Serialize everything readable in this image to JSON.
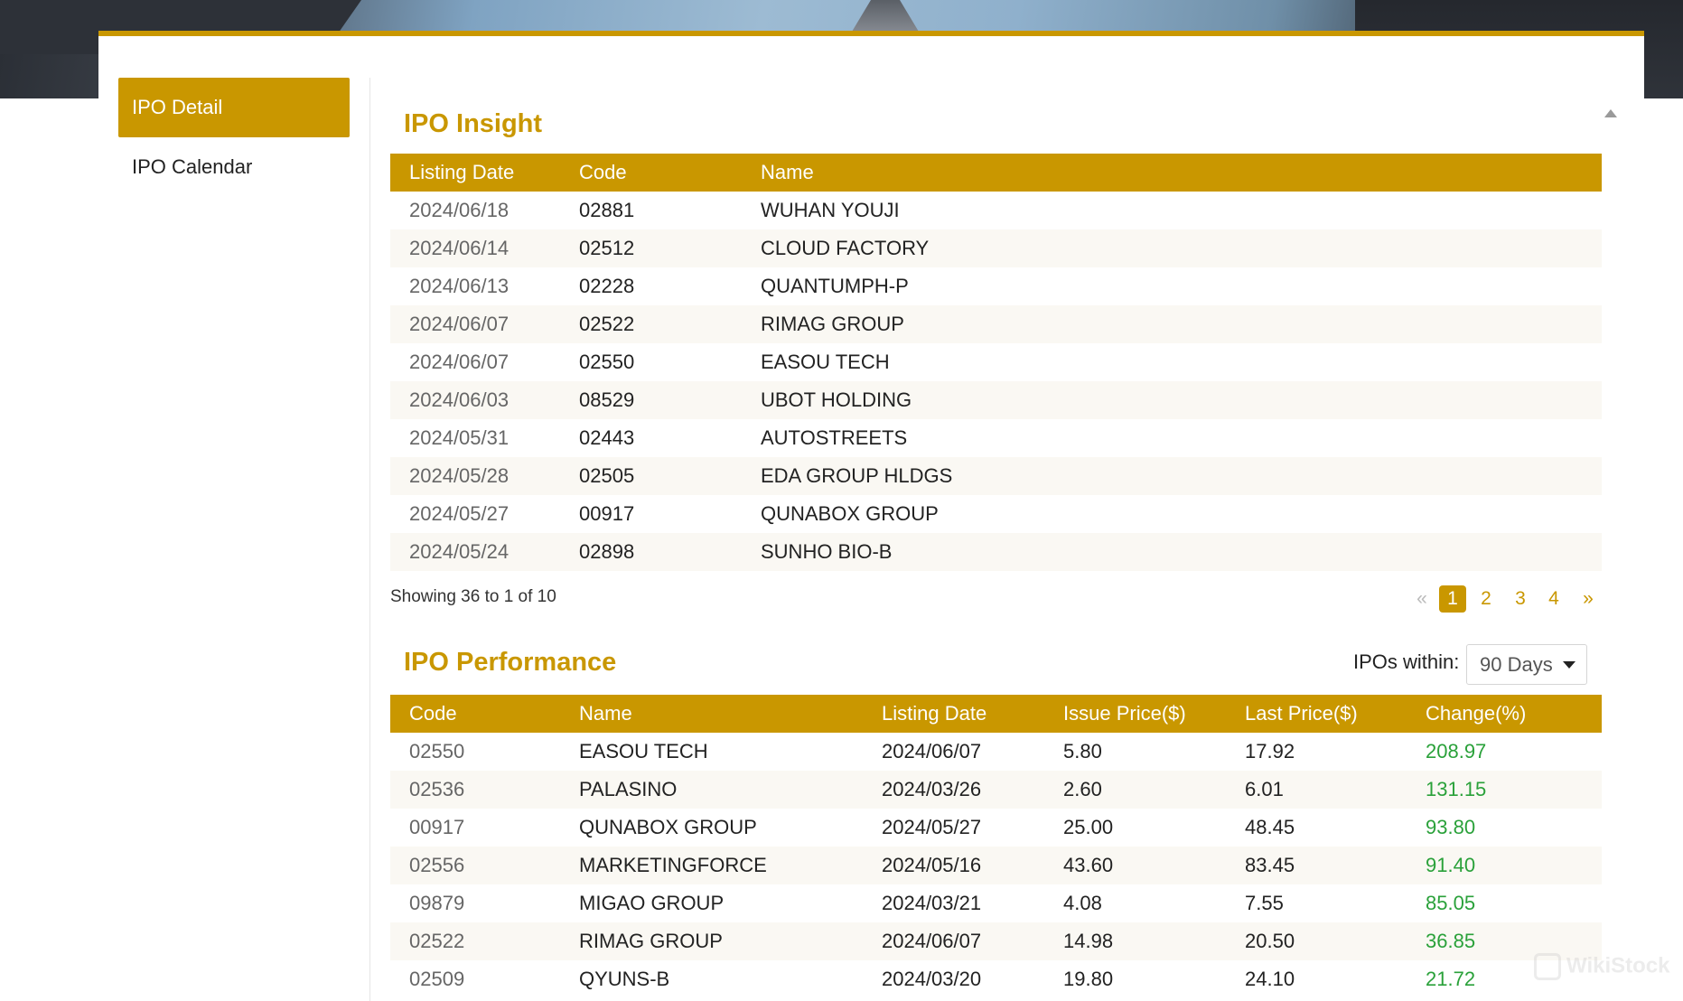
{
  "sidebar": {
    "items": [
      {
        "label": "IPO Detail",
        "active": true
      },
      {
        "label": "IPO Calendar",
        "active": false
      }
    ]
  },
  "insight": {
    "title": "IPO Insight",
    "columns": [
      "Listing Date",
      "Code",
      "Name"
    ],
    "rows": [
      [
        "2024/06/18",
        "02881",
        "WUHAN YOUJI"
      ],
      [
        "2024/06/14",
        "02512",
        "CLOUD FACTORY"
      ],
      [
        "2024/06/13",
        "02228",
        "QUANTUMPH-P"
      ],
      [
        "2024/06/07",
        "02522",
        "RIMAG GROUP"
      ],
      [
        "2024/06/07",
        "02550",
        "EASOU TECH"
      ],
      [
        "2024/06/03",
        "08529",
        "UBOT HOLDING"
      ],
      [
        "2024/05/31",
        "02443",
        "AUTOSTREETS"
      ],
      [
        "2024/05/28",
        "02505",
        "EDA GROUP HLDGS"
      ],
      [
        "2024/05/27",
        "00917",
        "QUNABOX GROUP"
      ],
      [
        "2024/05/24",
        "02898",
        "SUNHO BIO-B"
      ]
    ],
    "showing": "Showing 36 to 1 of 10",
    "pagination": {
      "prev": "«",
      "pages": [
        "1",
        "2",
        "3",
        "4"
      ],
      "current": "1",
      "next": "»"
    }
  },
  "performance": {
    "title": "IPO Performance",
    "filter_label": "IPOs within:",
    "filter_value": "90 Days",
    "columns": [
      "Code",
      "Name",
      "Listing Date",
      "Issue Price($)",
      "Last Price($)",
      "Change(%)"
    ],
    "rows": [
      [
        "02550",
        "EASOU TECH",
        "2024/06/07",
        "5.80",
        "17.92",
        "208.97"
      ],
      [
        "02536",
        "PALASINO",
        "2024/03/26",
        "2.60",
        "6.01",
        "131.15"
      ],
      [
        "00917",
        "QUNABOX GROUP",
        "2024/05/27",
        "25.00",
        "48.45",
        "93.80"
      ],
      [
        "02556",
        "MARKETINGFORCE",
        "2024/05/16",
        "43.60",
        "83.45",
        "91.40"
      ],
      [
        "09879",
        "MIGAO GROUP",
        "2024/03/21",
        "4.08",
        "7.55",
        "85.05"
      ],
      [
        "02522",
        "RIMAG GROUP",
        "2024/06/07",
        "14.98",
        "20.50",
        "36.85"
      ],
      [
        "02509",
        "QYUNS-B",
        "2024/03/20",
        "19.80",
        "24.10",
        "21.72"
      ]
    ]
  },
  "colors": {
    "accent": "#c99700",
    "positive": "#2aa13a"
  },
  "watermark": "WikiStock"
}
